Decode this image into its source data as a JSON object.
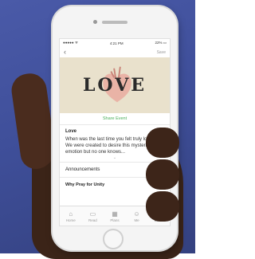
{
  "status_bar": {
    "carrier": "●●●●● ᯤ",
    "time": "4:21 PM",
    "battery": "22% ▭"
  },
  "nav": {
    "back_icon": "‹",
    "action": "Save"
  },
  "banner": {
    "title": "LOVE"
  },
  "share_label": "Share Event",
  "event": {
    "title": "Love",
    "body": "When was the last time you felt truly loved? We were created to desire this mysterious emotion but no one knows..."
  },
  "rows": [
    {
      "label": "Announcements"
    }
  ],
  "section_title": "Why Pray for Unity",
  "tabs": [
    {
      "label": "Home",
      "icon": "⌂",
      "icon_name": "home-icon"
    },
    {
      "label": "Read",
      "icon": "▭",
      "icon_name": "book-icon"
    },
    {
      "label": "Plans",
      "icon": "▦",
      "icon_name": "calendar-icon"
    },
    {
      "label": "Me",
      "icon": "☺",
      "icon_name": "person-icon"
    },
    {
      "label": "More",
      "icon": "☰",
      "icon_name": "more-icon"
    }
  ],
  "colors": {
    "accent": "#4bb05a",
    "background": "#3f4f9a"
  }
}
